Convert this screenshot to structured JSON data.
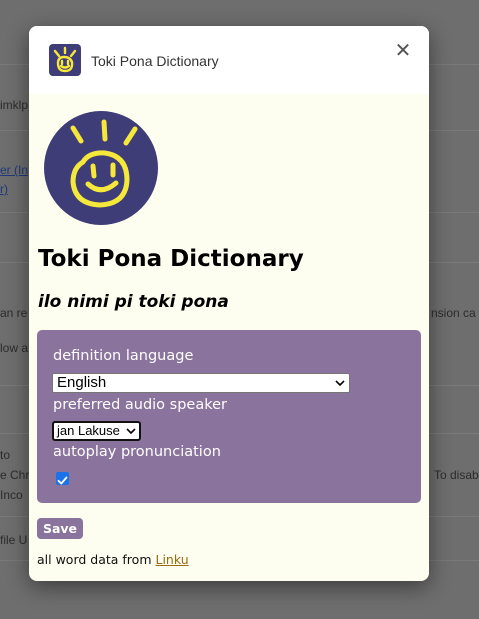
{
  "background": {
    "fragments": [
      {
        "text": "imklp"
      },
      {
        "text": "er (In"
      },
      {
        "text": "r)"
      },
      {
        "text": "an re"
      },
      {
        "text": "nsion ca"
      },
      {
        "text": "low a"
      },
      {
        "text": "to"
      },
      {
        "text": "e Chr"
      },
      {
        "text": "To disab"
      },
      {
        "text": "Inco"
      },
      {
        "text": "file U"
      }
    ]
  },
  "dialog": {
    "header_title": "Toki Pona Dictionary",
    "close_glyph": "✕",
    "title": "Toki Pona Dictionary",
    "subtitle": "ilo nimi pi toki pona",
    "settings": {
      "definition_language_label": "definition language",
      "definition_language_value": "English",
      "audio_speaker_label": "preferred audio speaker",
      "audio_speaker_value": "jan Lakuse",
      "autoplay_label": "autoplay pronunciation",
      "autoplay_checked": true
    },
    "save_label": "Save",
    "footer_text": "all word data from ",
    "footer_link": "Linku"
  },
  "colors": {
    "panel": "#8a739c",
    "logo_bg": "#3f3d78",
    "logo_fg": "#f5e83a",
    "checkbox": "#1a73e8"
  }
}
